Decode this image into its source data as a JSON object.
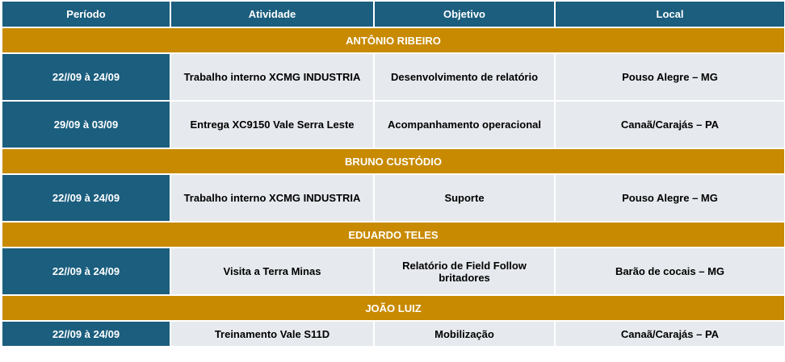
{
  "headers": {
    "period": "Período",
    "activity": "Atividade",
    "objective": "Objetivo",
    "location": "Local"
  },
  "groups": [
    {
      "person": "ANTÔNIO RIBEIRO",
      "rows": [
        {
          "period": "22//09 à 24/09",
          "activity": "Trabalho interno XCMG INDUSTRIA",
          "objective": "Desenvolvimento de relatório",
          "location": "Pouso Alegre – MG"
        },
        {
          "period": "29/09 à 03/09",
          "activity": "Entrega XC9150 Vale Serra Leste",
          "objective": "Acompanhamento operacional",
          "location": "Canaã/Carajás – PA"
        }
      ]
    },
    {
      "person": "BRUNO CUSTÓDIO",
      "rows": [
        {
          "period": "22//09 à 24/09",
          "activity": "Trabalho interno XCMG INDUSTRIA",
          "objective": "Suporte",
          "location": "Pouso Alegre – MG"
        }
      ]
    },
    {
      "person": "EDUARDO TELES",
      "rows": [
        {
          "period": "22//09 à 24/09",
          "activity": "Visita a Terra Minas",
          "objective_line1": "Relatório de Field Follow",
          "objective_line2": "britadores",
          "location": "Barão de cocais – MG"
        }
      ]
    },
    {
      "person": "JOÃO LUIZ",
      "rows": [
        {
          "period": "22//09 à 24/09",
          "activity": "Treinamento Vale S11D",
          "objective": "Mobilização",
          "location": "Canaã/Carajás – PA"
        }
      ]
    }
  ],
  "colors": {
    "header_bg": "#1b5e7e",
    "person_bg": "#c88a00",
    "cell_bg": "#e6e9ed"
  }
}
